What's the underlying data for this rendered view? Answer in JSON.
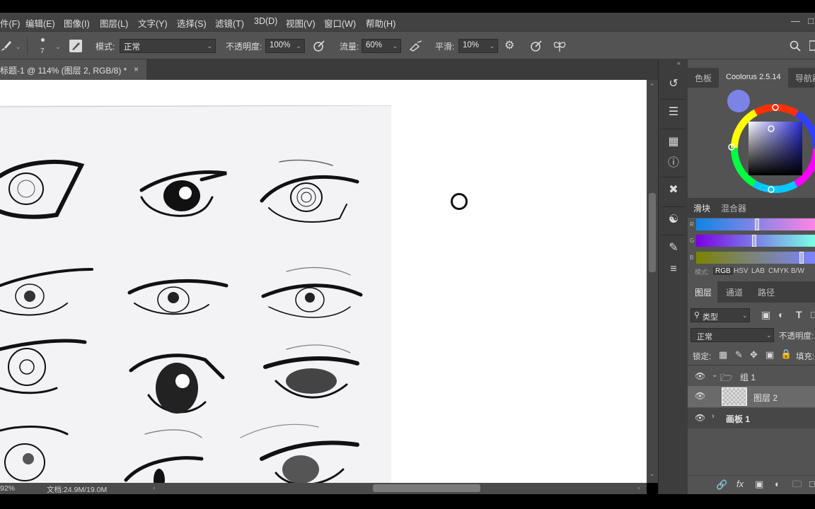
{
  "menu": [
    "件(F)",
    "编辑(E)",
    "图像(I)",
    "图层(L)",
    "文字(Y)",
    "选择(S)",
    "滤镜(T)",
    "3D(D)",
    "视图(V)",
    "窗口(W)",
    "帮助(H)"
  ],
  "options": {
    "brush_size": "7",
    "mode_label": "模式:",
    "mode_value": "正常",
    "opacity_label": "不透明度:",
    "opacity_value": "100%",
    "flow_label": "流量:",
    "flow_value": "60%",
    "smooth_label": "平滑:",
    "smooth_value": "10%"
  },
  "document_tab": {
    "title": "标题-1 @ 114% (图层 2, RGB/8) *",
    "close": "×"
  },
  "status": {
    "zoom": "92%",
    "doc_size": "文档:24.9M/19.0M"
  },
  "color_panel": {
    "tabs": [
      "色板",
      "Coolorus 2.5.14",
      "导航器"
    ],
    "foreground_color": "#7b84e6",
    "sub_tabs": [
      "滑块",
      "混合器"
    ],
    "channel_labels": [
      "R",
      "G",
      "B"
    ],
    "mode_label": "模式:",
    "modes": [
      "RGB",
      "HSV",
      "LAB",
      "CMYK",
      "B/W"
    ],
    "active_mode": "RGB"
  },
  "layers_panel": {
    "tabs": [
      "图层",
      "通道",
      "路径"
    ],
    "filter_label": "类型",
    "blend_mode": "正常",
    "opacity_label": "不透明度:",
    "lock_label": "锁定:",
    "fill_label": "填充:",
    "layers": [
      {
        "name": "组 1",
        "type": "group",
        "expanded": true
      },
      {
        "name": "图层 2",
        "type": "layer",
        "selected": true
      },
      {
        "name": "画板 1",
        "type": "artboard",
        "expanded": false
      }
    ]
  }
}
